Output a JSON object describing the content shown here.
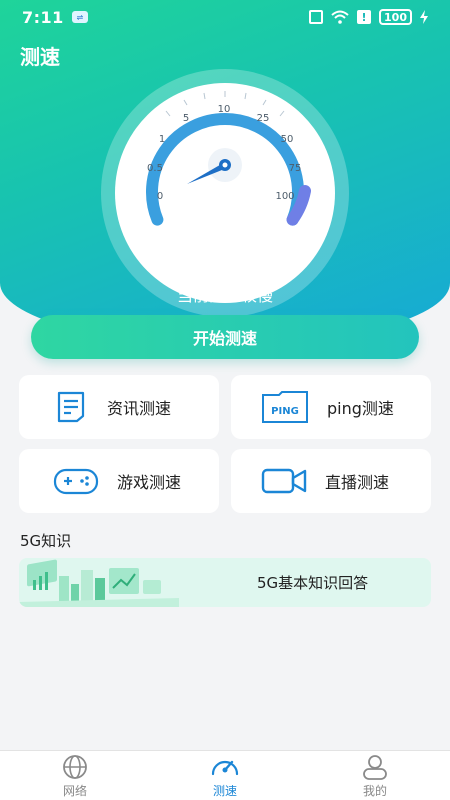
{
  "status_bar": {
    "time": "7:11",
    "battery": "100"
  },
  "header": {
    "title": "测速"
  },
  "gauge": {
    "ticks": [
      "0",
      "0.5",
      "1",
      "5",
      "10",
      "25",
      "50",
      "75",
      "100"
    ],
    "caption": "当前网速较慢"
  },
  "start_button": {
    "label": "开始测速"
  },
  "features": [
    {
      "label": "资讯测速",
      "icon": "document-icon"
    },
    {
      "label": "ping测速",
      "icon": "ping-icon",
      "icon_text": "PING"
    },
    {
      "label": "游戏测速",
      "icon": "gamepad-icon"
    },
    {
      "label": "直播测速",
      "icon": "video-camera-icon"
    }
  ],
  "knowledge": {
    "section_title": "5G知识",
    "banner_label": "5G基本知识回答"
  },
  "tabbar": {
    "items": [
      {
        "label": "网络",
        "icon": "globe-icon"
      },
      {
        "label": "测速",
        "icon": "speedometer-icon",
        "active": true
      },
      {
        "label": "我的",
        "icon": "user-icon"
      }
    ]
  },
  "colors": {
    "accent": "#1b86d6",
    "gradient_start": "#1fd49a",
    "gradient_end": "#17a9d6"
  }
}
